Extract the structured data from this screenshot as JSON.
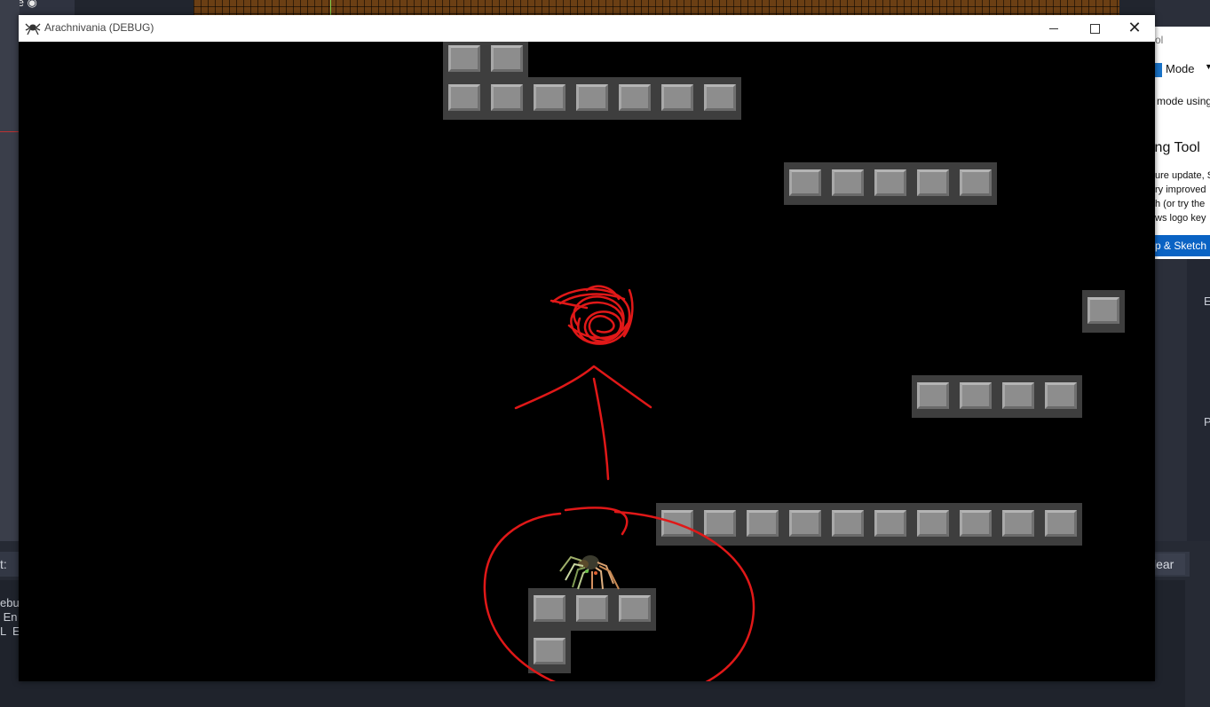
{
  "window": {
    "title": "Arachnivania (DEBUG)",
    "controls": {
      "minimize": "minimize",
      "maximize": "maximize",
      "close": "✕"
    }
  },
  "background": {
    "top_tab": "File ◉",
    "console_label": "t:",
    "console_lines": "ebu\n En\nL  E",
    "clear_button": "lear",
    "right_letters": [
      "E",
      "P"
    ],
    "snip": {
      "title": "ol",
      "mode_label": "Mode",
      "line1": "mode using",
      "heading": "ing Tool",
      "body": "ure update, S\nry improved\nh (or try the\nws logo key",
      "button": "p & Sketch"
    }
  },
  "game": {
    "player": "spider",
    "annotation": "red scribble, arrow pointing up, circle around player"
  }
}
